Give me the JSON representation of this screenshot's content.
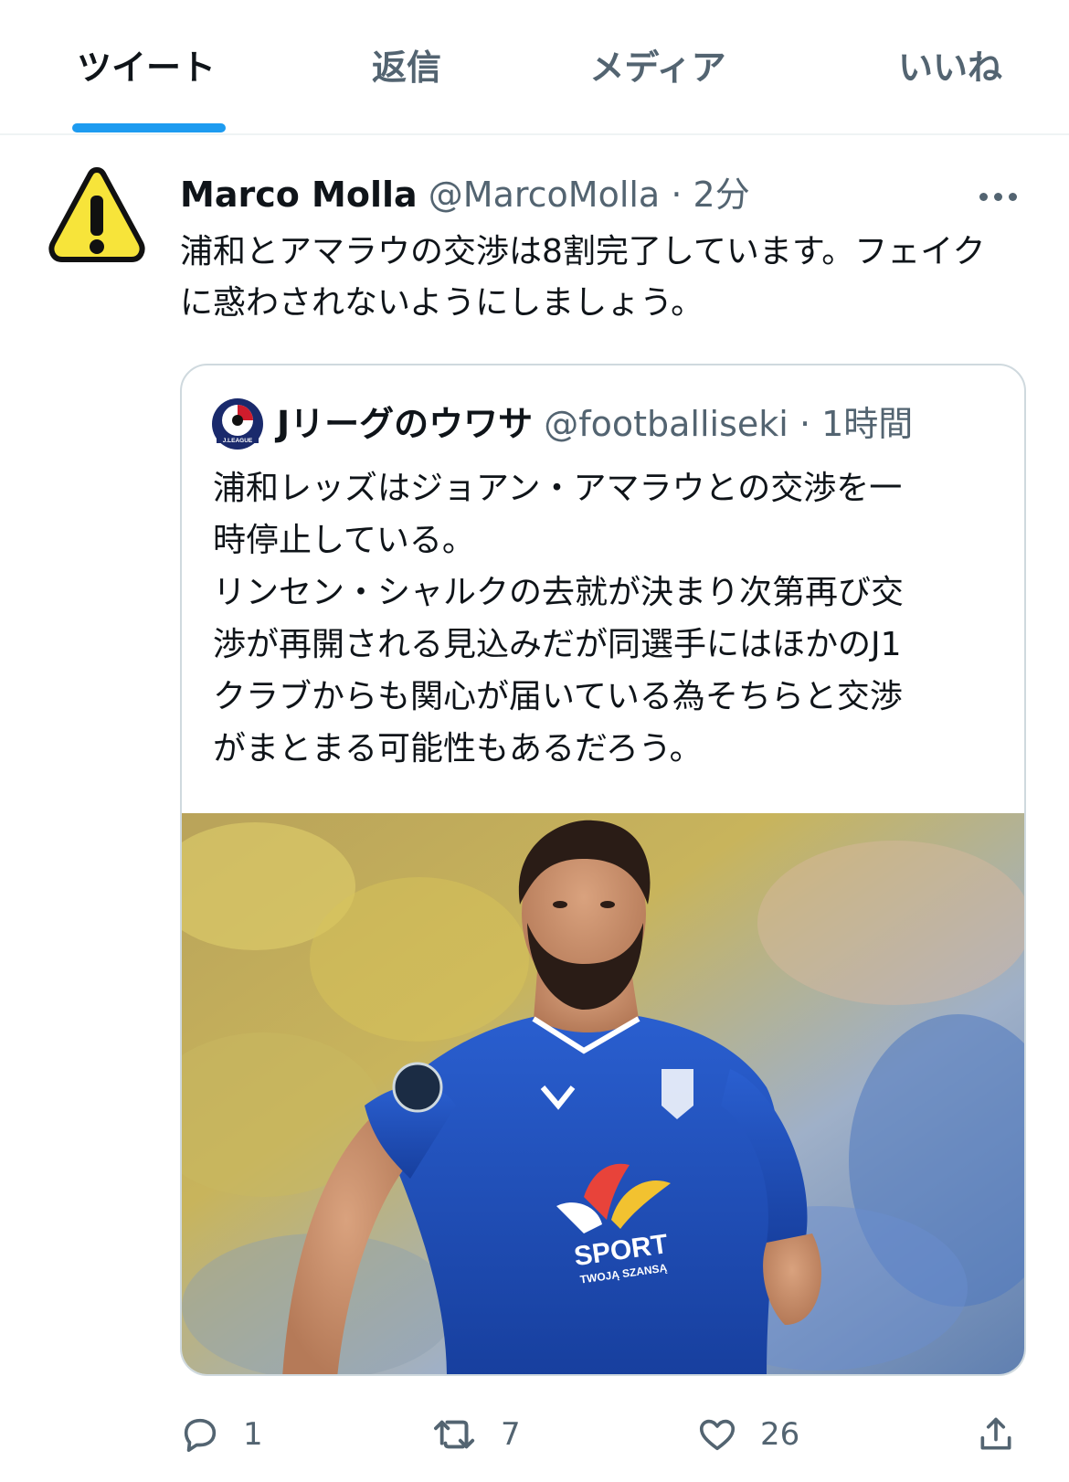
{
  "tabs": [
    {
      "label": "ツイート",
      "active": true
    },
    {
      "label": "返信",
      "active": false
    },
    {
      "label": "メディア",
      "active": false
    },
    {
      "label": "いいね",
      "active": false
    }
  ],
  "tweet": {
    "display_name": "Marco Molla",
    "handle": "@MarcoMolla",
    "time": "2分",
    "text": "浦和とアマラウの交渉は8割完了しています。フェイクに惑わされないようにしましょう。",
    "avatar_icon": "warning-icon"
  },
  "quote": {
    "display_name": "Jリーグのウワサ",
    "handle": "@footballiseki",
    "time": "1時間",
    "avatar_label": "J.LEAGUE",
    "text_lines": [
      "浦和レッズはジョアン・アマラウとの交渉を一",
      "時停止している。",
      "リンセン・シャルクの去就が決まり次第再び交",
      "渉が再開される見込みだが同選手にはほかのJ1",
      "クラブからも関心が届いている為そちらと交渉",
      "がまとまる可能性もあるだろう。"
    ],
    "image": {
      "sponsor_text": "SPORT",
      "sponsor_subtext": "TWOJĄ SZANSĄ"
    }
  },
  "actions": {
    "replies": "1",
    "retweets": "7",
    "likes": "26"
  },
  "colors": {
    "accent": "#1d9bf0",
    "secondary_text": "#536471",
    "border": "#cfd9de",
    "warning_yellow": "#f7e43a",
    "jersey_blue": "#1f4fb8"
  }
}
